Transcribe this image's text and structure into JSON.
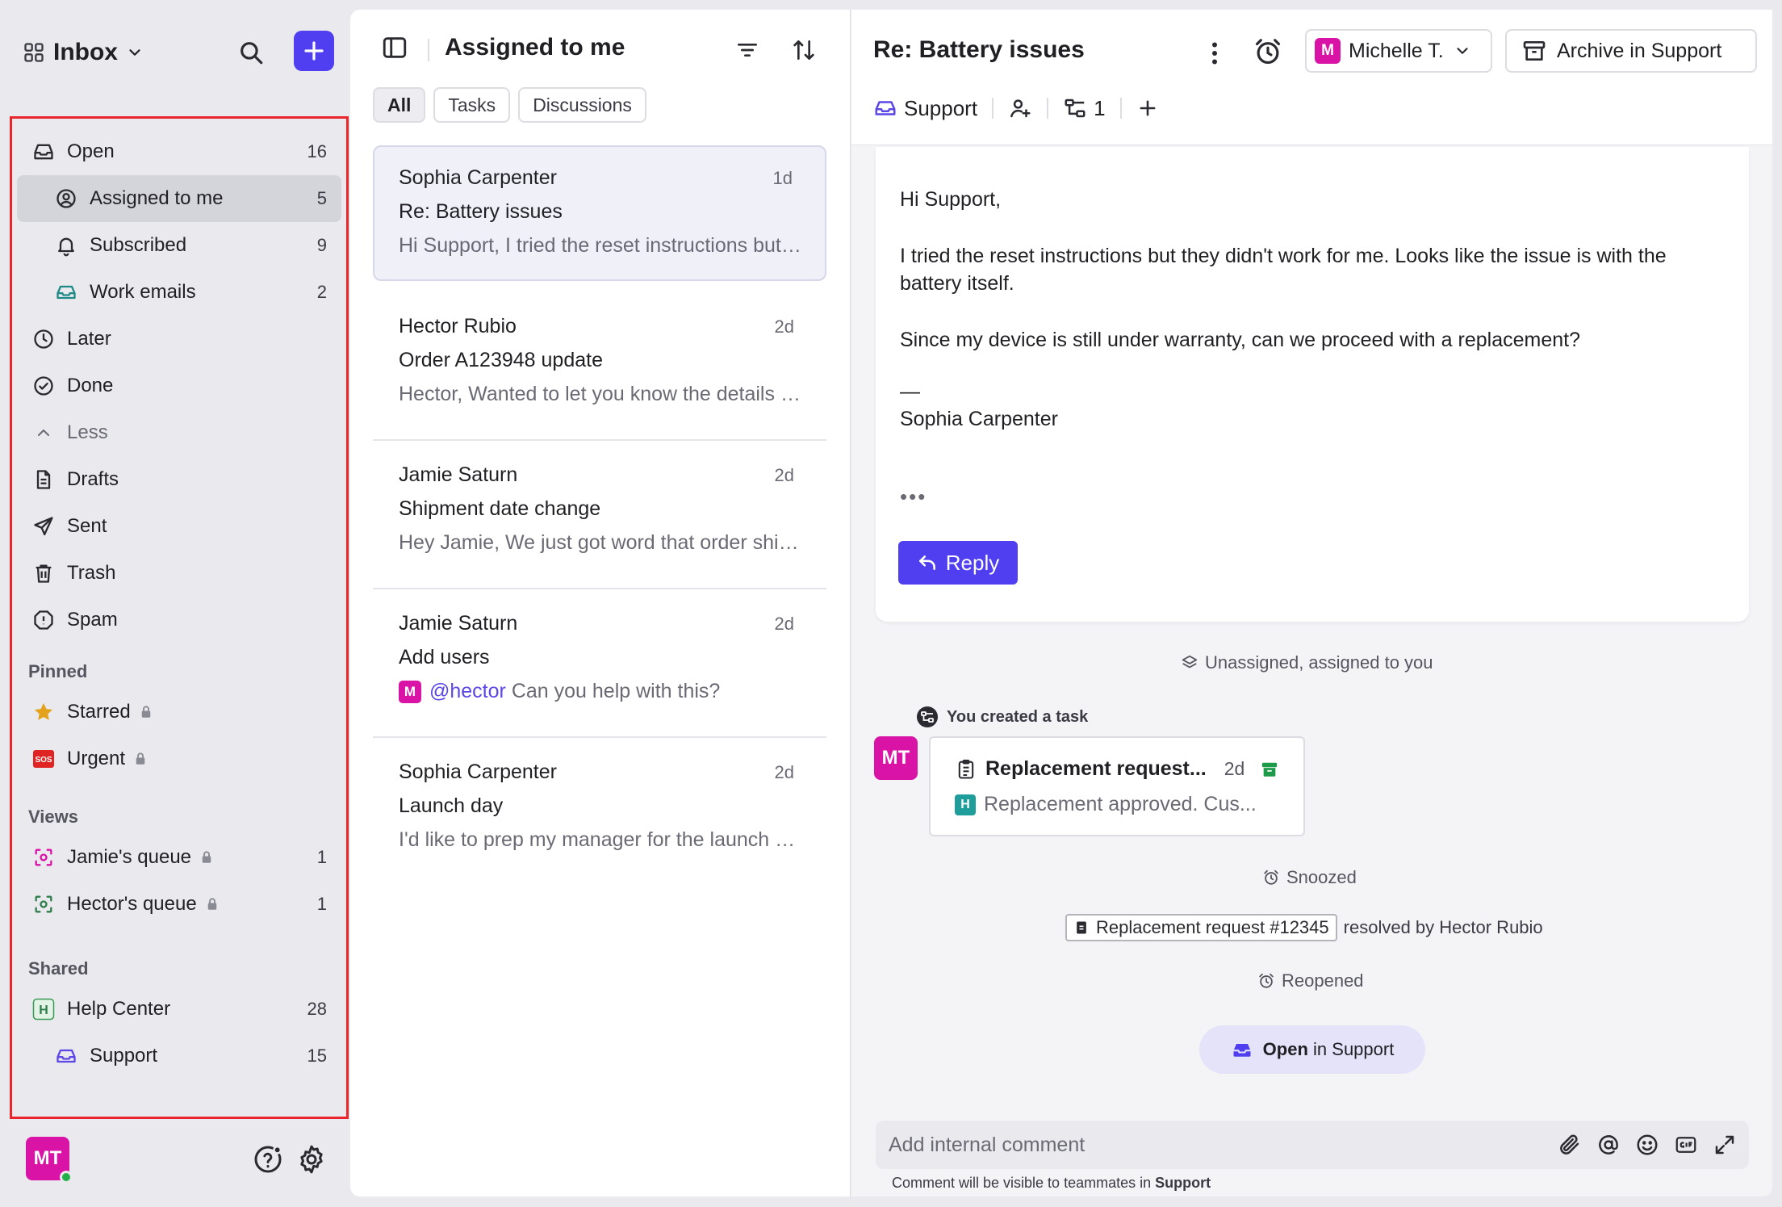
{
  "sidebar": {
    "inbox_label": "Inbox",
    "nav": [
      {
        "label": "Open",
        "count": "16"
      },
      {
        "label": "Assigned to me",
        "count": "5"
      },
      {
        "label": "Subscribed",
        "count": "9"
      },
      {
        "label": "Work emails",
        "count": "2"
      },
      {
        "label": "Later"
      },
      {
        "label": "Done"
      },
      {
        "label": "Less"
      },
      {
        "label": "Drafts"
      },
      {
        "label": "Sent"
      },
      {
        "label": "Trash"
      },
      {
        "label": "Spam"
      }
    ],
    "pinned_title": "Pinned",
    "pinned": [
      {
        "label": "Starred"
      },
      {
        "label": "Urgent",
        "badge": "SOS"
      }
    ],
    "views_title": "Views",
    "views": [
      {
        "label": "Jamie's queue",
        "count": "1"
      },
      {
        "label": "Hector's queue",
        "count": "1"
      }
    ],
    "shared_title": "Shared",
    "shared": [
      {
        "label": "Help Center",
        "count": "28",
        "badge": "H"
      },
      {
        "label": "Support",
        "count": "15"
      }
    ],
    "user_initials": "MT"
  },
  "list": {
    "title": "Assigned to me",
    "tabs": [
      "All",
      "Tasks",
      "Discussions"
    ],
    "conversations": [
      {
        "from": "Sophia Carpenter",
        "time": "1d",
        "subject": "Re: Battery issues",
        "preview": "Hi Support, I tried the reset instructions but they didn't work for me."
      },
      {
        "from": "Hector Rubio",
        "time": "2d",
        "subject": "Order A123948 update",
        "preview": "Hector, Wanted to let you know the details of the order."
      },
      {
        "from": "Jamie Saturn",
        "time": "2d",
        "subject": "Shipment date change",
        "preview": "Hey Jamie, We just got word that order shipment is delayed."
      },
      {
        "from": "Jamie Saturn",
        "time": "2d",
        "subject": "Add users",
        "preview_badge": "M",
        "preview_mention": "@hector",
        "preview": " Can you help with this?"
      },
      {
        "from": "Sophia Carpenter",
        "time": "2d",
        "subject": "Launch day",
        "preview": "I'd like to prep my manager for the launch day."
      }
    ]
  },
  "detail": {
    "title": "Re: Battery issues",
    "assignee_initial": "M",
    "assignee": "Michelle T.",
    "archive_label": "Archive in Support",
    "inbox_tag": "Support",
    "task_count": "1",
    "message": {
      "greeting": "Hi Support,",
      "para1": "I tried the reset instructions but they didn't work for me. Looks like the issue is with the battery itself.",
      "para2": "Since my device is still under warranty, can we proceed with a replacement?",
      "sig_dash": "—",
      "signature": "Sophia Carpenter",
      "dots": "•••"
    },
    "reply_label": "Reply",
    "activity_assigned": "Unassigned, assigned to you",
    "task_created_label": "You created a task",
    "task_avatar": "MT",
    "task_title": "Replacement request...",
    "task_due": "2d",
    "task_desc_badge": "H",
    "task_desc": "Replacement approved. Cus...",
    "activity_snoozed": "Snoozed",
    "resolved_ref": "Replacement request #12345",
    "resolved_text": "resolved by Hector Rubio",
    "activity_reopened": "Reopened",
    "open_pill_bold": "Open",
    "open_pill_rest": "in Support",
    "comment_placeholder": "Add internal comment",
    "comment_note_prefix": "Comment will be visible to teammates in",
    "comment_note_team": "Support"
  },
  "colors": {
    "accent": "#4f3ff0",
    "avatar_magenta": "#d913a6",
    "highlight_border": "#e8262b",
    "teal_badge": "#1f9d9b"
  }
}
